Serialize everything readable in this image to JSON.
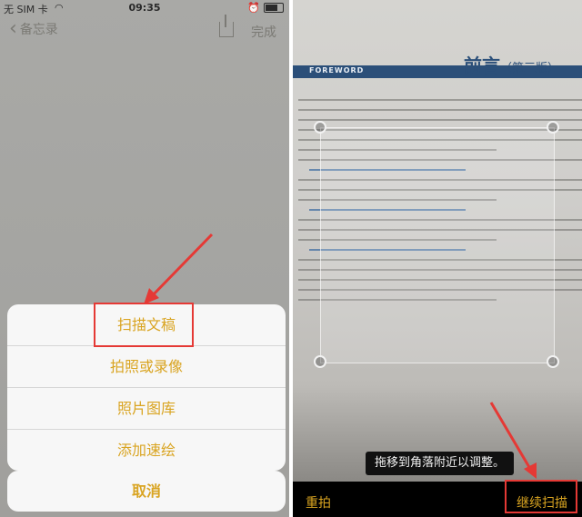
{
  "status": {
    "carrier": "无 SIM 卡",
    "time": "09:35"
  },
  "nav": {
    "back_label": "备忘录",
    "done_label": "完成"
  },
  "action_sheet": {
    "options": [
      "扫描文稿",
      "拍照或录像",
      "照片图库",
      "添加速绘"
    ],
    "cancel": "取消"
  },
  "scanner": {
    "foreword": "FOREWORD",
    "title": "前言",
    "edition": "（第三版）",
    "hint": "拖移到角落附近以调整。",
    "retake": "重拍",
    "continue": "继续扫描"
  },
  "colors": {
    "accent": "#d9a421",
    "highlight": "#e53935",
    "band": "#2b4f79"
  }
}
